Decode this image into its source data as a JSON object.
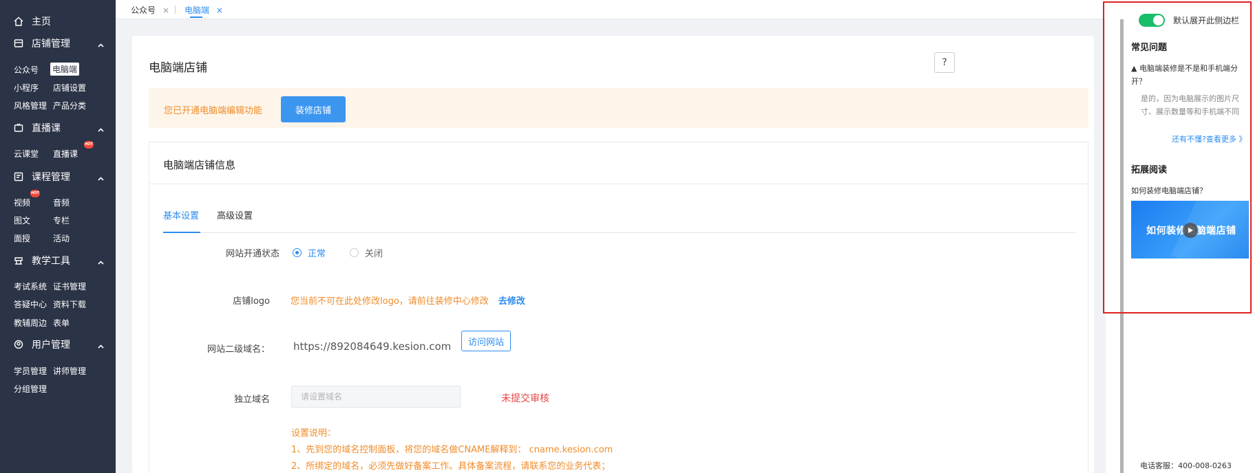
{
  "sidebar": {
    "home": "主页",
    "sections": {
      "store": {
        "label": "店铺管理",
        "items": [
          "公众号",
          "电脑端",
          "小程序",
          "店铺设置",
          "风格管理",
          "产品分类"
        ]
      },
      "live": {
        "label": "直播课",
        "items": [
          "云课堂",
          "直播课"
        ]
      },
      "course": {
        "label": "课程管理",
        "items": [
          "视频",
          "音频",
          "图文",
          "专栏",
          "面授",
          "活动"
        ]
      },
      "tools": {
        "label": "教学工具",
        "items": [
          "考试系统",
          "证书管理",
          "答疑中心",
          "资料下载",
          "教辅周边",
          "表单"
        ]
      },
      "users": {
        "label": "用户管理",
        "items": [
          "学员管理",
          "讲师管理",
          "分组管理"
        ]
      }
    },
    "hot_badge": "HOT"
  },
  "topbar": {
    "tabs": [
      {
        "label": "公众号",
        "close": "×"
      },
      {
        "label": "电脑端",
        "close": "×"
      }
    ]
  },
  "main": {
    "title": "电脑端店铺",
    "help": "?",
    "notice": "您已开通电脑端编辑功能",
    "decorate_button": "装修店铺",
    "info_title": "电脑端店铺信息",
    "tabs": [
      "基本设置",
      "高级设置"
    ],
    "form": {
      "status_label": "网站开通状态",
      "status_on": "正常",
      "status_off": "关闭",
      "logo_label": "店铺logo",
      "logo_text": "您当前不可在此处修改logo，请前往装修中心修改",
      "logo_link": "去修改",
      "subdomain_label": "网站二级域名：",
      "subdomain_value": "https://892084649.kesion.com",
      "visit_button": "访问网站",
      "domain_label": "独立域名",
      "domain_placeholder": "请设置域名",
      "domain_status": "未提交审核",
      "instructions": [
        "设置说明：",
        "1、先到您的域名控制面板，将您的域名做CNAME解释到： cname.kesion.com",
        "2、所绑定的域名，必须先做好备案工作。具体备案流程，请联系您的业务代表；"
      ]
    }
  },
  "right_panel": {
    "toggle_label": "默认展开此侧边栏",
    "toggle_on": true,
    "faq_title": "常见问题",
    "faq_question": "电脑端装修是不是和手机端分开？",
    "faq_answer": "是的，因为电脑展示的图片尺寸、展示数量等和手机端不同",
    "more_link": "还有不懂?查看更多 》",
    "reading_title": "拓展阅读",
    "reading_item": "如何装修电脑端店铺？",
    "video_title": "如何装修电脑端店铺",
    "phone": "电话客服：400-008-0263"
  },
  "colors": {
    "sidebar_bg": "#2b3346",
    "accent": "#2d8cf0",
    "warning": "#f08c2a",
    "error": "#e84545",
    "toggle_on": "#19be6b"
  }
}
